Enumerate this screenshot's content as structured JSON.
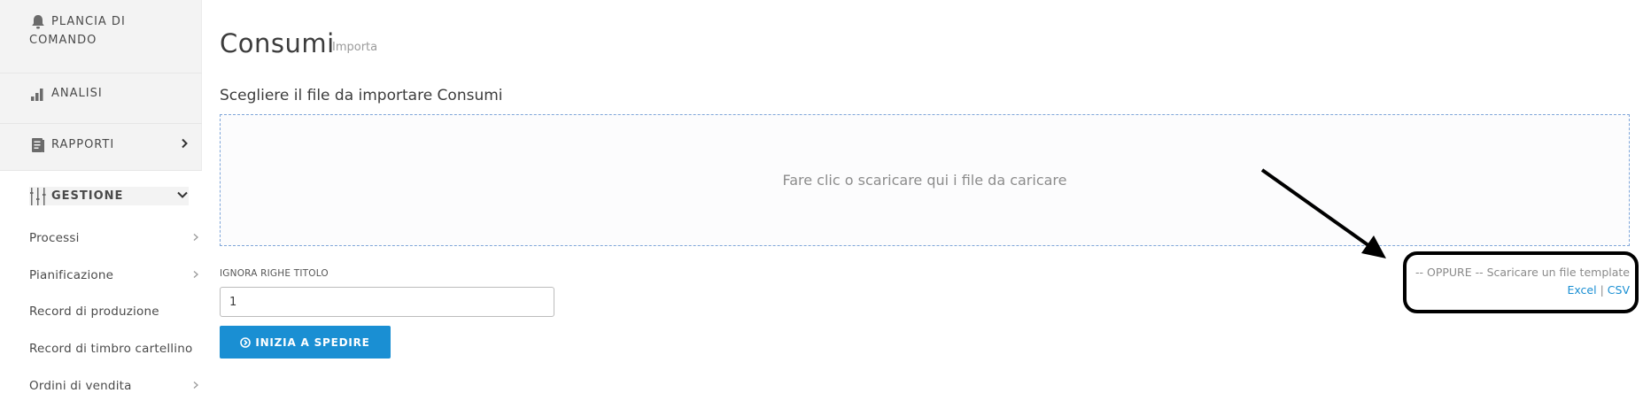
{
  "sidebar": {
    "items": [
      {
        "label": "PLANCIA DI",
        "label2": "COMANDO",
        "icon": "bell-icon"
      },
      {
        "label": "ANALISI",
        "icon": "bar-chart-icon"
      },
      {
        "label": "RAPPORTI",
        "icon": "document-icon",
        "chevron": "right"
      },
      {
        "label": "GESTIONE",
        "icon": "sliders-icon",
        "chevron": "down",
        "active": true
      }
    ],
    "subitems": [
      {
        "label": "Processi",
        "has_chevron": true
      },
      {
        "label": "Pianificazione",
        "has_chevron": true
      },
      {
        "label": "Record di produzione",
        "has_chevron": false
      },
      {
        "label": "Record di timbro cartellino",
        "has_chevron": false
      },
      {
        "label": "Ordini di vendita",
        "has_chevron": true
      }
    ]
  },
  "main": {
    "title": "Consumi",
    "subtitle": "Importa",
    "section_title": "Scegliere il file da importare Consumi",
    "dropzone_text": "Fare clic o scaricare qui i file da caricare",
    "ignore_label": "IGNORA RIGHE TITOLO",
    "ignore_value": "1",
    "start_button": "INIZIA A SPEDIRE",
    "template_text": "-- OPPURE -- Scaricare un file template",
    "template_links": {
      "excel": "Excel",
      "separator": "|",
      "csv": "CSV"
    }
  },
  "colors": {
    "accent": "#1a8fd3",
    "sidebar_bg": "#f3f3f3",
    "dropzone_border": "#7fa6d9"
  }
}
